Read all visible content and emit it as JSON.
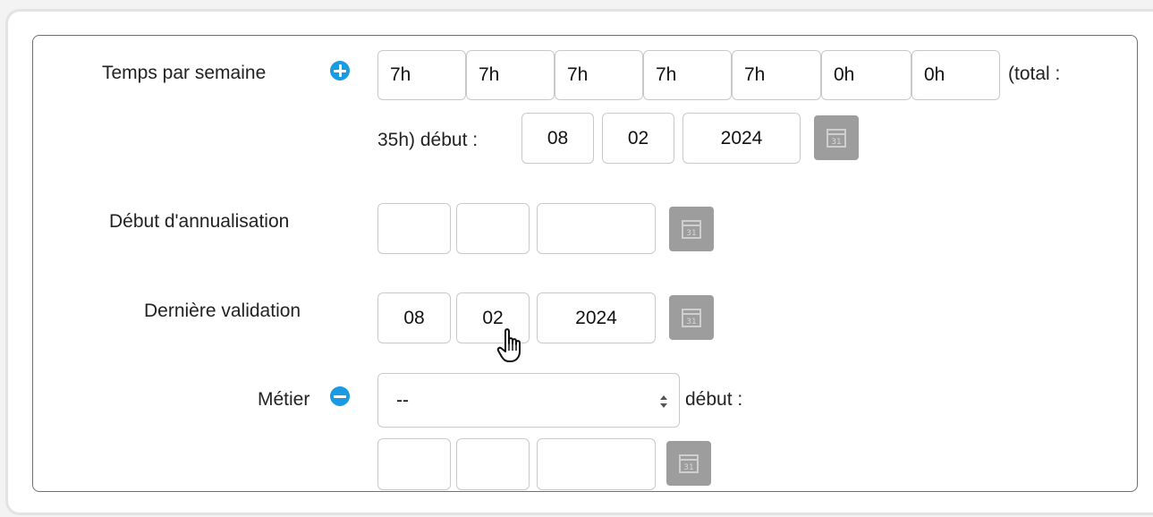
{
  "weekly_hours": {
    "label": "Temps par semaine",
    "days": [
      "7h",
      "7h",
      "7h",
      "7h",
      "7h",
      "0h",
      "0h"
    ],
    "total_open": "(total :",
    "total_close_start": "35h) début :",
    "start_date": {
      "day": "08",
      "month": "02",
      "year": "2024"
    }
  },
  "annualisation": {
    "label": "Début d'annualisation",
    "date": {
      "day": "",
      "month": "",
      "year": ""
    }
  },
  "last_validation": {
    "label": "Dernière validation",
    "date": {
      "day": "08",
      "month": "02",
      "year": "2024"
    }
  },
  "job": {
    "label": "Métier",
    "selected": "--",
    "start_label": "début :",
    "date": {
      "day": "",
      "month": "",
      "year": ""
    }
  },
  "icons": {
    "add": "plus-circle-icon",
    "remove": "minus-circle-icon",
    "calendar": "calendar-icon",
    "cursor": "hand-pointer-cursor"
  },
  "colors": {
    "accent": "#1a9ae0",
    "calendar_button": "#9d9d9d"
  }
}
